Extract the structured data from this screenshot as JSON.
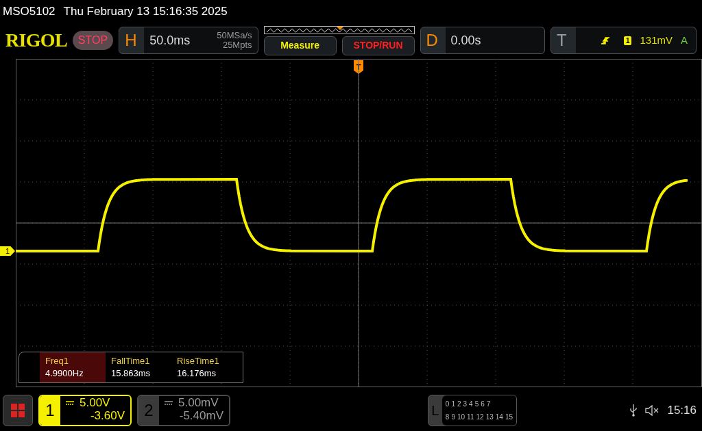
{
  "title_bar": {
    "model": "MSO5102",
    "datetime": "Thu February 13 15:16:35 2025"
  },
  "logo": "RIGOL",
  "run_state": {
    "label": "STOP"
  },
  "horizontal": {
    "letter": "H",
    "timebase": "50.0ms",
    "sample_rate": "50MSa/s",
    "memory_depth": "25Mpts"
  },
  "buttons": [
    {
      "label": "Measure",
      "kind": "measure"
    },
    {
      "label": "STOP/RUN",
      "kind": "stoprun"
    }
  ],
  "delay": {
    "letter": "D",
    "value": "0.00s"
  },
  "trigger": {
    "letter": "T",
    "source": "1",
    "level": "131mV",
    "mode": "A"
  },
  "trigger_marker": "T",
  "channel_marker": "1",
  "measurements": [
    {
      "name": "Freq1",
      "value": "4.9900Hz",
      "selected": true
    },
    {
      "name": "FallTime1",
      "value": "15.863ms",
      "selected": false
    },
    {
      "name": "RiseTime1",
      "value": "16.176ms",
      "selected": false
    }
  ],
  "channels": [
    {
      "number": "1",
      "scale": "5.00V",
      "offset": "-3.60V",
      "selected": true
    },
    {
      "number": "2",
      "scale": "5.00mV",
      "offset": "-5.40mV",
      "selected": false
    }
  ],
  "logic": {
    "letter": "L",
    "row_1": [
      "0",
      "1",
      "2",
      "3",
      "4",
      "5",
      "6",
      "7"
    ],
    "row_2": [
      "8",
      "9",
      "10",
      "11",
      "12",
      "13",
      "14",
      "15"
    ]
  },
  "status": {
    "time": "15:16"
  }
}
